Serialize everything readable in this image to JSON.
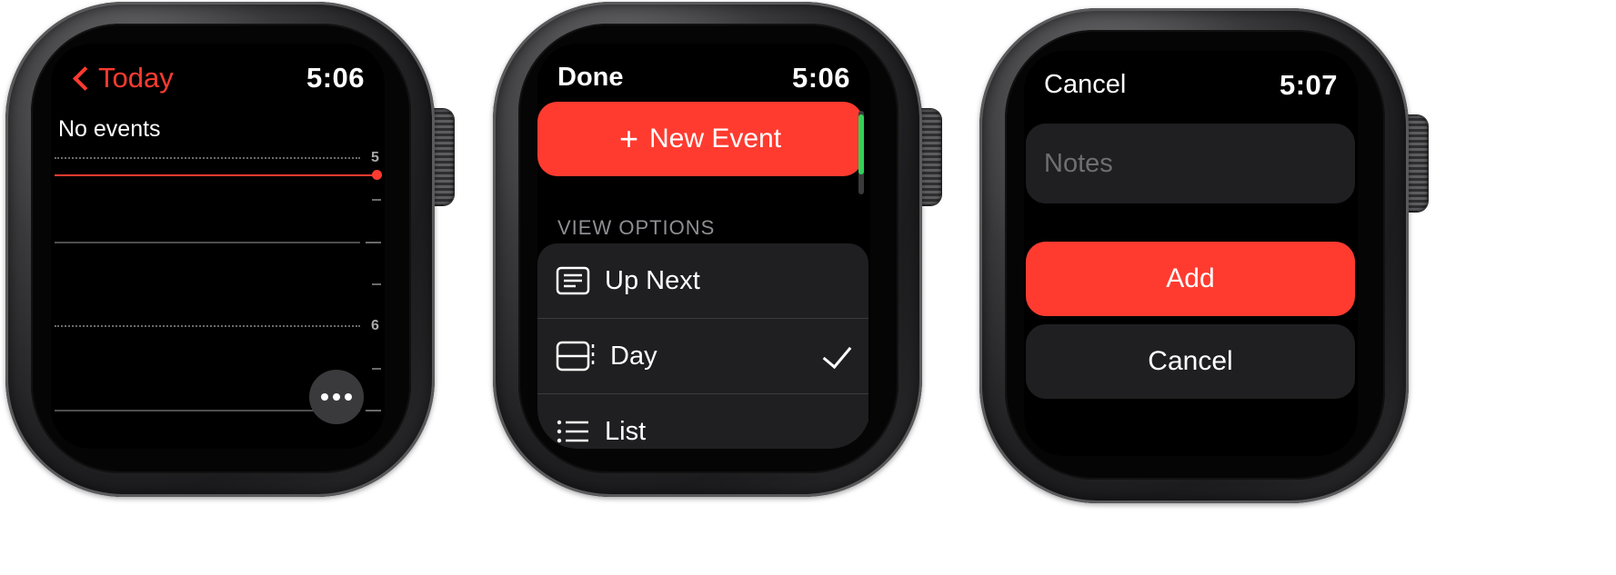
{
  "watch1": {
    "back_label": "Today",
    "time": "5:06",
    "no_events": "No events",
    "hour_5": "5",
    "hour_6": "6",
    "more_button": "more-options"
  },
  "watch2": {
    "done_label": "Done",
    "time": "5:06",
    "new_event_label": "New Event",
    "section_header": "VIEW OPTIONS",
    "options": [
      {
        "label": "Up Next",
        "icon": "up-next-icon",
        "selected": false
      },
      {
        "label": "Day",
        "icon": "day-view-icon",
        "selected": true
      },
      {
        "label": "List",
        "icon": "list-icon",
        "selected": false
      }
    ]
  },
  "watch3": {
    "cancel_label": "Cancel",
    "time": "5:07",
    "notes_placeholder": "Notes",
    "add_label": "Add",
    "cancel_button_label": "Cancel"
  },
  "colors": {
    "accent_red": "#ff3b30",
    "scroll_green": "#30d158",
    "cell_bg": "#1f1f21"
  }
}
